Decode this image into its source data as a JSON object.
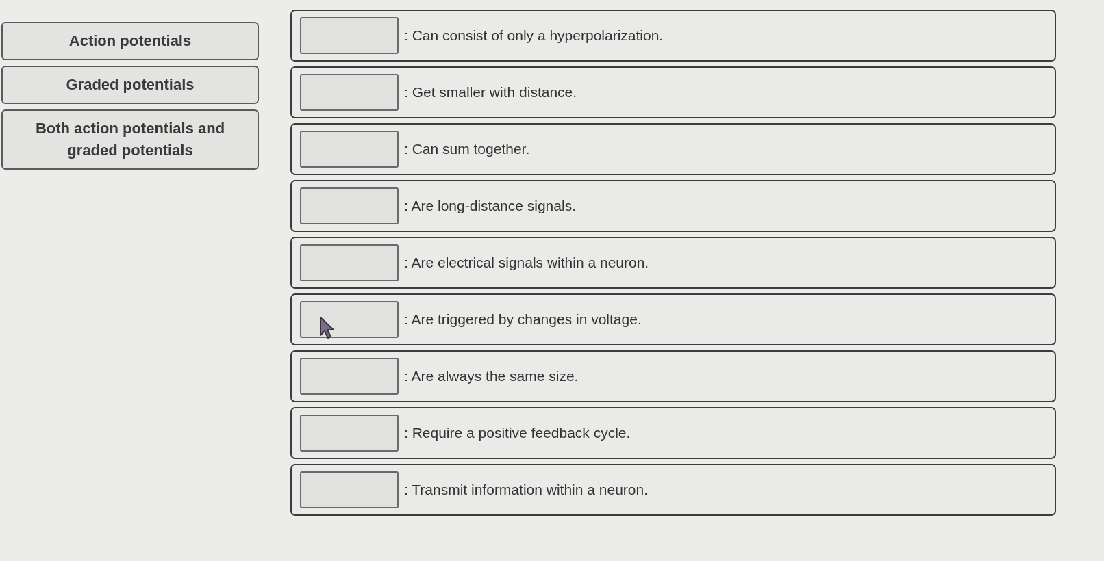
{
  "answer_choices": [
    {
      "label": "Action potentials"
    },
    {
      "label": "Graded potentials"
    },
    {
      "label": "Both action potentials and graded potentials"
    }
  ],
  "statements": [
    {
      "text": ": Can consist of only a hyperpolarization."
    },
    {
      "text": ": Get smaller with distance."
    },
    {
      "text": ": Can sum together."
    },
    {
      "text": ": Are long-distance signals."
    },
    {
      "text": ": Are electrical signals within a neuron."
    },
    {
      "text": ": Are triggered by changes in voltage."
    },
    {
      "text": ": Are always the same size."
    },
    {
      "text": ": Require a positive feedback cycle."
    },
    {
      "text": ": Transmit information within a neuron."
    }
  ]
}
